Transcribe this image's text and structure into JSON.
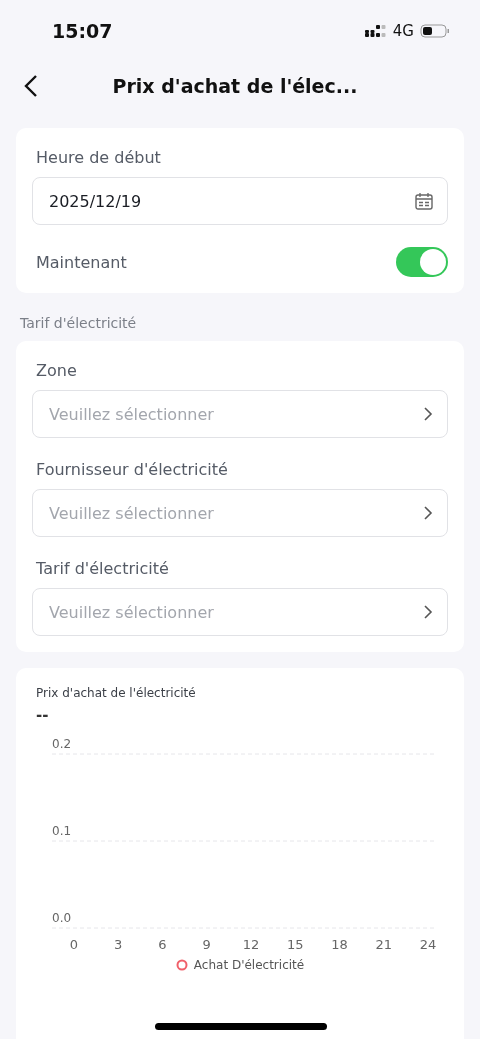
{
  "status_bar": {
    "time": "15:07",
    "network": "4G"
  },
  "header": {
    "title": "Prix d'achat de l'élec..."
  },
  "start_card": {
    "label": "Heure de début",
    "date": "2025/12/19",
    "now_label": "Maintenant",
    "now_on": true
  },
  "tariff_section": {
    "title": "Tarif d'électricité",
    "fields": [
      {
        "label": "Zone",
        "placeholder": "Veuillez sélectionner"
      },
      {
        "label": "Fournisseur d'électricité",
        "placeholder": "Veuillez sélectionner"
      },
      {
        "label": "Tarif d'électricité",
        "placeholder": "Veuillez sélectionner"
      }
    ]
  },
  "chart_card": {
    "title": "Prix d'achat de l'électricité",
    "value": "--",
    "chart_data": {
      "type": "line",
      "categories": [
        "0",
        "3",
        "6",
        "9",
        "12",
        "15",
        "18",
        "21",
        "24"
      ],
      "yticks": [
        {
          "value": 0,
          "label": "0.0"
        },
        {
          "value": 0.1,
          "label": "0.1"
        },
        {
          "value": 0.2,
          "label": "0.2"
        }
      ],
      "ylim": [
        0,
        0.2
      ],
      "series": [
        {
          "name": "Achat D'électricité",
          "color": "#f0606a",
          "values": [
            null,
            null,
            null,
            null,
            null,
            null,
            null,
            null,
            null
          ]
        }
      ]
    }
  }
}
